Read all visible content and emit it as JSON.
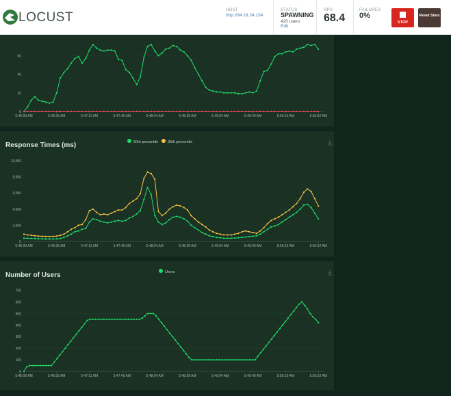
{
  "header": {
    "logo_text": "LOCUST",
    "host_label": "HOST",
    "host_url": "http://34.18.24.134",
    "status_label": "STATUS",
    "status_value": "SPAWNING",
    "status_users": "420 users",
    "status_edit": "Edit",
    "rps_label": "RPS",
    "rps_value": "68.4",
    "failures_label": "FAILURES",
    "failures_value": "0%",
    "stop_label": "STOP",
    "reset_label": "Reset Stats"
  },
  "colors": {
    "green": "#1fdc6a",
    "yellow": "#f6c545",
    "red": "#ff4d5a",
    "panel": "#1a3124",
    "background": "#12251c"
  },
  "chart_data": [
    {
      "id": "rps",
      "type": "line",
      "title": "",
      "x": [
        "5:46:09 AM",
        "5:46:35 AM",
        "5:47:11 AM",
        "5:47:40 AM",
        "5:48:04 AM",
        "5:48:28 AM",
        "5:49:04 AM",
        "5:49:40 AM",
        "5:50:16 AM",
        "5:50:52 AM"
      ],
      "yticks": [
        0,
        20,
        40,
        60
      ],
      "ylim": [
        0,
        75
      ],
      "series": [
        {
          "color": "green",
          "values": [
            0,
            5,
            12,
            16,
            12,
            11,
            10,
            9,
            10,
            20,
            36,
            42,
            46,
            52,
            57,
            59,
            52,
            57,
            66,
            72,
            68,
            66,
            65,
            66,
            66,
            65,
            56,
            55,
            45,
            42,
            36,
            29,
            37,
            58,
            70,
            72,
            65,
            60,
            63,
            67,
            68,
            71,
            70,
            66,
            64,
            60,
            55,
            47,
            40,
            33,
            26,
            23,
            22,
            21,
            21,
            20,
            20,
            20,
            20,
            19,
            19,
            20,
            21,
            20,
            22,
            33,
            43,
            44,
            51,
            59,
            62,
            62,
            64,
            65,
            64,
            67,
            68,
            69,
            72,
            71,
            72,
            67
          ]
        },
        {
          "color": "red",
          "values": [
            0,
            0,
            0,
            0,
            0,
            0,
            0,
            0,
            0,
            0,
            0,
            0,
            0,
            0,
            0,
            0,
            0,
            0,
            0,
            0,
            0,
            0,
            0,
            0,
            0,
            0,
            0,
            0,
            0,
            0,
            0,
            0,
            0,
            0,
            0,
            0,
            0,
            0,
            0,
            0,
            0,
            0,
            0,
            0,
            0,
            0,
            0,
            0,
            0,
            0,
            0,
            0,
            0,
            0,
            0,
            0,
            0,
            0,
            0,
            0,
            0,
            0,
            0,
            0,
            0,
            0,
            0,
            0,
            0,
            0,
            0,
            0,
            0,
            0,
            0,
            0,
            0,
            0,
            0,
            0,
            0,
            0
          ]
        }
      ]
    },
    {
      "id": "response",
      "type": "line",
      "title": "Response Times (ms)",
      "x": [
        "5:46:09 AM",
        "5:46:35 AM",
        "5:47:11 AM",
        "5:47:40 AM",
        "5:48:04 AM",
        "5:48:28 AM",
        "5:49:04 AM",
        "5:49:40 AM",
        "5:50:16 AM",
        "5:50:52 AM"
      ],
      "yticks": [
        0,
        2000,
        4000,
        6000,
        8000,
        10000
      ],
      "yticklabels": [
        "0",
        "2,000",
        "4,000",
        "6,000",
        "8,000",
        "10,000"
      ],
      "ylim": [
        0,
        10000
      ],
      "series": [
        {
          "name": "50th percentile",
          "color": "green",
          "values": [
            400,
            380,
            370,
            350,
            330,
            320,
            310,
            300,
            310,
            320,
            350,
            500,
            700,
            900,
            1200,
            1300,
            1500,
            1600,
            2400,
            2800,
            2700,
            2500,
            2400,
            2300,
            2400,
            2500,
            2600,
            2500,
            2600,
            2900,
            3100,
            3400,
            3800,
            5200,
            6700,
            5800,
            3200,
            2400,
            2100,
            2300,
            2700,
            3000,
            3100,
            3000,
            2800,
            2500,
            2000,
            1700,
            1400,
            1100,
            900,
            700,
            600,
            500,
            450,
            400,
            390,
            400,
            420,
            450,
            500,
            550,
            600,
            650,
            700,
            900,
            1200,
            1500,
            1800,
            1900,
            2100,
            2400,
            2700,
            3000,
            3300,
            3600,
            4000,
            4500,
            4600,
            4200,
            3500,
            2800
          ]
        },
        {
          "name": "95th percentile",
          "color": "yellow",
          "values": [
            900,
            800,
            760,
            700,
            660,
            640,
            620,
            610,
            630,
            660,
            750,
            900,
            1200,
            1500,
            1700,
            2000,
            2100,
            2700,
            3800,
            4000,
            3600,
            3300,
            3400,
            3300,
            3500,
            3700,
            3900,
            3900,
            4200,
            4700,
            5000,
            5300,
            5900,
            7800,
            8600,
            8400,
            7700,
            3700,
            3200,
            3500,
            4000,
            4300,
            4500,
            4400,
            4200,
            3900,
            3200,
            2800,
            2400,
            2100,
            1800,
            1400,
            1200,
            1000,
            900,
            820,
            800,
            810,
            900,
            1000,
            1200,
            1300,
            1200,
            1100,
            1000,
            1300,
            1700,
            2200,
            2600,
            2800,
            3000,
            3300,
            3600,
            3900,
            4300,
            4700,
            5300,
            6100,
            6500,
            6200,
            5300,
            4400
          ]
        }
      ]
    },
    {
      "id": "users",
      "type": "line",
      "title": "Number of Users",
      "x": [
        "5:46:09 AM",
        "5:46:35 AM",
        "5:47:11 AM",
        "5:47:40 AM",
        "5:48:04 AM",
        "5:48:28 AM",
        "5:49:04 AM",
        "5:49:40 AM",
        "5:50:16 AM",
        "5:50:52 AM"
      ],
      "yticks": [
        0,
        100,
        200,
        300,
        400,
        500,
        600,
        700
      ],
      "ylim": [
        0,
        750
      ],
      "series": [
        {
          "name": "Users",
          "color": "green",
          "values": [
            0,
            40,
            50,
            50,
            50,
            50,
            50,
            50,
            50,
            50,
            50,
            80,
            110,
            140,
            170,
            200,
            230,
            260,
            290,
            320,
            350,
            380,
            410,
            440,
            450,
            450,
            450,
            450,
            450,
            450,
            450,
            450,
            450,
            450,
            450,
            450,
            450,
            450,
            450,
            450,
            450,
            450,
            450,
            460,
            480,
            500,
            500,
            500,
            480,
            450,
            420,
            390,
            360,
            330,
            300,
            270,
            240,
            210,
            180,
            150,
            120,
            100,
            100,
            100,
            100,
            100,
            100,
            100,
            100,
            100,
            100,
            100,
            100,
            100,
            100,
            100,
            100,
            100,
            100,
            100,
            100,
            100,
            100,
            100,
            100,
            130,
            160,
            190,
            220,
            250,
            280,
            310,
            340,
            370,
            400,
            430,
            460,
            490,
            520,
            550,
            580,
            600,
            570,
            540,
            500,
            470,
            450,
            420
          ]
        }
      ]
    }
  ]
}
